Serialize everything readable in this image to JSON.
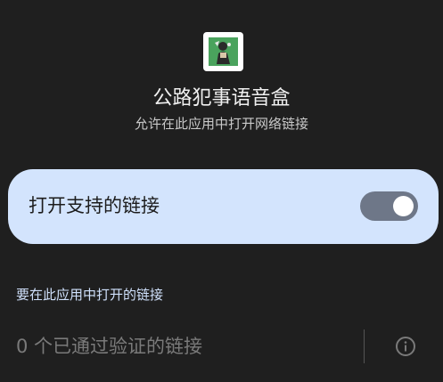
{
  "app": {
    "icon": "app-icon",
    "title": "公路犯事语音盒",
    "subtitle": "允许在此应用中打开网络链接"
  },
  "toggle_card": {
    "label": "打开支持的链接",
    "switch_state": "on",
    "card_color": "#d3e4fd",
    "switch_color": "#6e7788"
  },
  "links_section": {
    "header": "要在此应用中打开的链接",
    "verified_text": "0 个已通过验证的链接",
    "info_icon": "info-icon"
  }
}
